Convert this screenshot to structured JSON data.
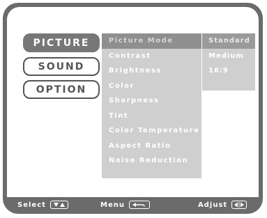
{
  "categories": [
    {
      "label": "PICTURE",
      "active": true
    },
    {
      "label": "SOUND",
      "active": false
    },
    {
      "label": "OPTION",
      "active": false
    }
  ],
  "menu_items": [
    "Picture Mode",
    "Contrast",
    "Brightness",
    "Color",
    "Sharpness",
    "Tint",
    "Color Temperature",
    "Aspect Ratio",
    "Noise Reduction"
  ],
  "selected_menu_index": 0,
  "submenu_options": [
    "Standard",
    "Medium",
    "16:9"
  ],
  "selected_submenu_index": 0,
  "footer": {
    "select_label": "Select",
    "menu_label": "Menu",
    "adjust_label": "Adjust"
  },
  "icons": {
    "select": "up-down-arrows-icon",
    "menu": "return-arrow-icon",
    "adjust": "left-right-arrows-icon"
  },
  "colors": {
    "frame": "#6b6b6b",
    "active_category": "#777777",
    "menu_bg": "#cfcfcf",
    "menu_highlight": "#8f8f8f"
  }
}
